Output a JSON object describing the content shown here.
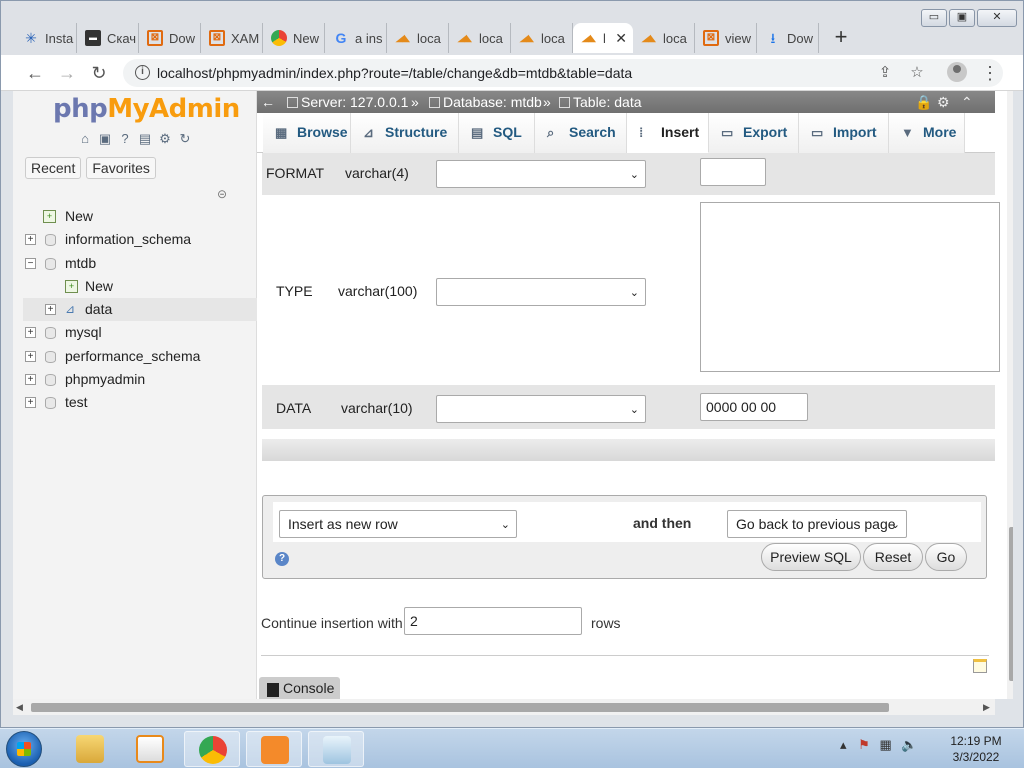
{
  "window_controls": {
    "minimize": "▭",
    "maximize": "▣",
    "close": "✕"
  },
  "tabs": [
    {
      "label": "Insta",
      "icon": "install-icon"
    },
    {
      "label": "Скач",
      "icon": "terminal-icon"
    },
    {
      "label": "Dow",
      "icon": "xampp-icon"
    },
    {
      "label": "XAM",
      "icon": "xampp-icon"
    },
    {
      "label": "New",
      "icon": "chrome-icon"
    },
    {
      "label": "a ins",
      "icon": "google-icon"
    },
    {
      "label": "loca",
      "icon": "phpmyadmin-icon"
    },
    {
      "label": "loca",
      "icon": "phpmyadmin-icon"
    },
    {
      "label": "loca",
      "icon": "phpmyadmin-icon"
    },
    {
      "label": "l",
      "icon": "phpmyadmin-icon",
      "active": true
    },
    {
      "label": "loca",
      "icon": "phpmyadmin-icon"
    },
    {
      "label": "view",
      "icon": "xampp-icon"
    },
    {
      "label": "Dow",
      "icon": "download-icon"
    }
  ],
  "toolbar": {
    "url": "localhost/phpmyadmin/index.php?route=/table/change&db=mtdb&table=data"
  },
  "nav": {
    "logo_php": "php",
    "logo_myadmin": "MyAdmin",
    "recent": "Recent",
    "favorites": "Favorites",
    "tree": [
      {
        "label": "New",
        "level": 0,
        "kind": "new"
      },
      {
        "label": "information_schema",
        "level": 0,
        "kind": "db",
        "expander": "+"
      },
      {
        "label": "mtdb",
        "level": 0,
        "kind": "db",
        "expander": "−"
      },
      {
        "label": "New",
        "level": 1,
        "kind": "new"
      },
      {
        "label": "data",
        "level": 1,
        "kind": "table",
        "expander": "+",
        "selected": true
      },
      {
        "label": "mysql",
        "level": 0,
        "kind": "db",
        "expander": "+"
      },
      {
        "label": "performance_schema",
        "level": 0,
        "kind": "db",
        "expander": "+"
      },
      {
        "label": "phpmyadmin",
        "level": 0,
        "kind": "db",
        "expander": "+"
      },
      {
        "label": "test",
        "level": 0,
        "kind": "db",
        "expander": "+"
      }
    ]
  },
  "breadcrumb": {
    "server": "Server: 127.0.0.1",
    "database": "Database: mtdb",
    "table": "Table: data",
    "sep": "»"
  },
  "menu": [
    {
      "label": "Browse",
      "icon": "browse-icon"
    },
    {
      "label": "Structure",
      "icon": "structure-icon"
    },
    {
      "label": "SQL",
      "icon": "sql-icon"
    },
    {
      "label": "Search",
      "icon": "search-icon"
    },
    {
      "label": "Insert",
      "icon": "insert-icon",
      "active": true
    },
    {
      "label": "Export",
      "icon": "export-icon"
    },
    {
      "label": "Import",
      "icon": "import-icon"
    },
    {
      "label": "More",
      "icon": "chevron-down-icon"
    }
  ],
  "fields": [
    {
      "name": "FORMAT",
      "type": "varchar(4)",
      "function": "",
      "value": ""
    },
    {
      "name": "TYPE",
      "type": "varchar(100)",
      "function": "",
      "value": ""
    },
    {
      "name": "DATA",
      "type": "varchar(10)",
      "function": "",
      "value": "0000 00 00"
    }
  ],
  "actions": {
    "insert_mode": "Insert as new row",
    "and_then": "and then",
    "after": "Go back to previous page",
    "preview": "Preview SQL",
    "reset": "Reset",
    "go": "Go"
  },
  "continue": {
    "label": "Continue insertion with",
    "value": "2",
    "suffix": "rows"
  },
  "console": "Console",
  "clock": {
    "time": "12:19 PM",
    "date": "3/3/2022"
  }
}
